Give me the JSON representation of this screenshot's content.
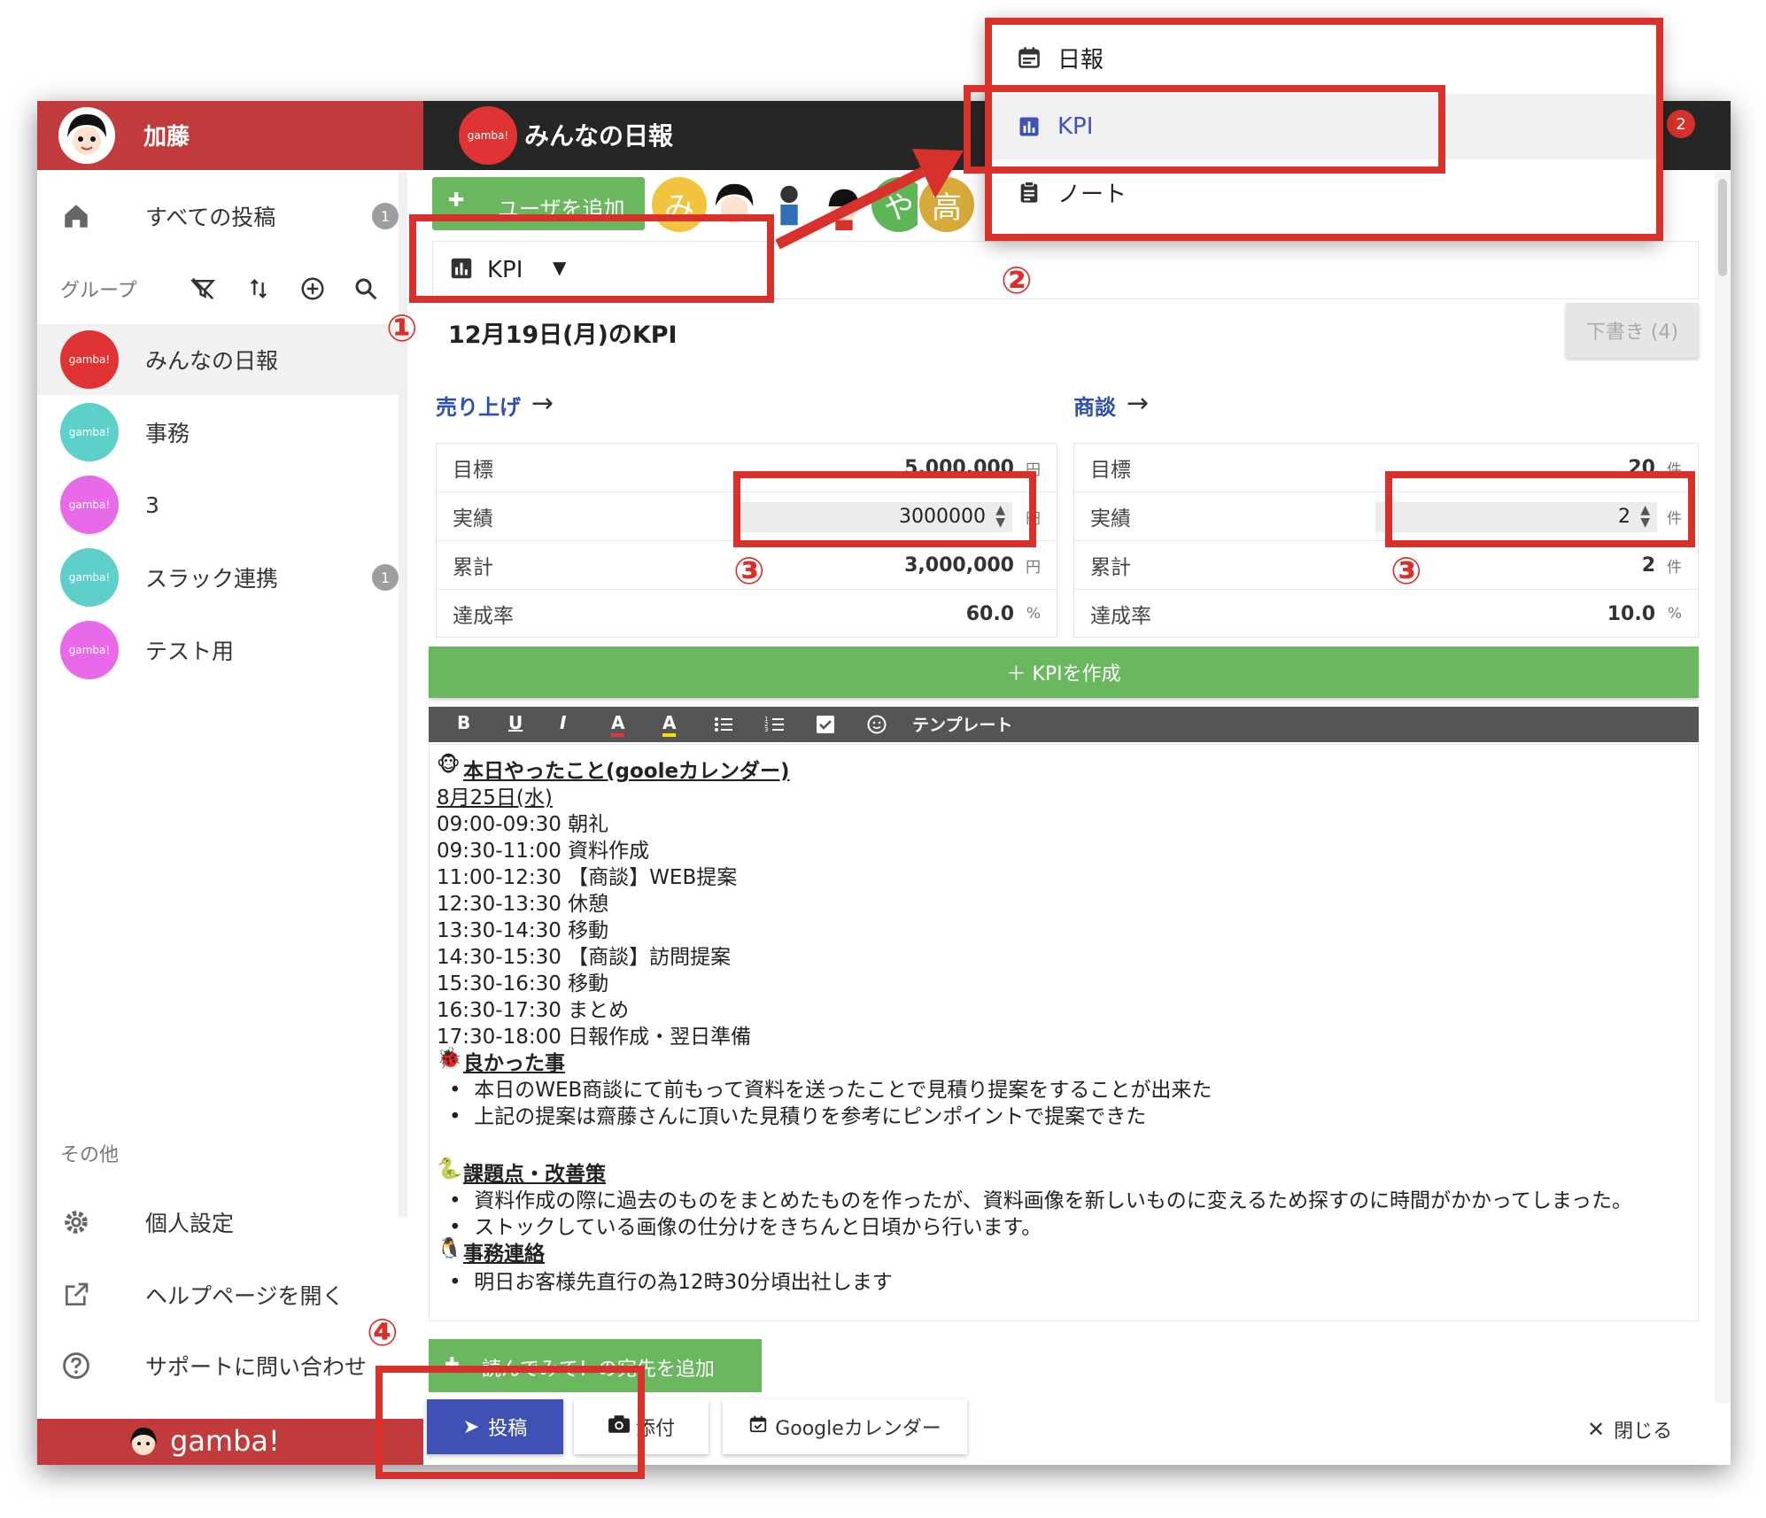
{
  "sidebar": {
    "user_name": "加藤",
    "nav": [
      {
        "label": "すべての投稿",
        "icon": "home-icon",
        "badge": "1"
      }
    ],
    "group_label": "グループ",
    "groups": [
      {
        "label": "みんなの日報",
        "color": "#e03434",
        "active": true
      },
      {
        "label": "事務",
        "color": "#5fd0c9"
      },
      {
        "label": "3",
        "color": "#e86ae8"
      },
      {
        "label": "スラック連携",
        "color": "#5fd0c9",
        "badge": "1"
      },
      {
        "label": "テスト用",
        "color": "#e86ae8"
      }
    ],
    "group_logo_text": "gamba!",
    "other_label": "その他",
    "others": [
      {
        "label": "個人設定",
        "icon": "gear-icon"
      },
      {
        "label": "ヘルプページを開く",
        "icon": "external-link-icon"
      },
      {
        "label": "サポートに問い合わせ",
        "icon": "help-circle-icon"
      }
    ],
    "footer_brand": "gamba!"
  },
  "topbar": {
    "logo_text": "gamba!",
    "title": "みんなの日報",
    "notification_count": "2"
  },
  "main": {
    "add_user_label": "ユーザを追加",
    "member_avatars": [
      "み",
      "や",
      "高"
    ],
    "type_selector": "KPI",
    "kpi_title": "12月19日(月)のKPI",
    "draft_label": "下書き (4)",
    "kpi_cards": [
      {
        "title": "売り上げ",
        "rows": [
          {
            "label": "目標",
            "value": "5,000,000",
            "unit": "円"
          },
          {
            "label": "実績",
            "input": "3000000",
            "unit": "円"
          },
          {
            "label": "累計",
            "value": "3,000,000",
            "unit": "円"
          },
          {
            "label": "達成率",
            "value": "60.0",
            "unit": "%"
          }
        ]
      },
      {
        "title": "商談",
        "rows": [
          {
            "label": "目標",
            "value": "20",
            "unit": "件"
          },
          {
            "label": "実績",
            "input": "2",
            "unit": "件"
          },
          {
            "label": "累計",
            "value": "2",
            "unit": "件"
          },
          {
            "label": "達成率",
            "value": "10.0",
            "unit": "%"
          }
        ]
      }
    ],
    "create_kpi_label": "＋ KPIを作成",
    "editor_toolbar": [
      "B",
      "U",
      "I",
      "A",
      "A",
      "ul",
      "ol",
      "check",
      "emoji"
    ],
    "template_label": "テンプレート",
    "report": {
      "heading1": "本日やったこと(gooleカレンダー)",
      "date": "8月25日(水)",
      "schedule": [
        "09:00-09:30 朝礼",
        "09:30-11:00 資料作成",
        "11:00-12:30 【商談】WEB提案",
        "12:30-13:30 休憩",
        "13:30-14:30 移動",
        "14:30-15:30 【商談】訪問提案",
        "15:30-16:30 移動",
        "16:30-17:30 まとめ",
        "17:30-18:00 日報作成・翌日準備"
      ],
      "heading2": "良かった事",
      "good": [
        "本日のWEB商談にて前もって資料を送ったことで見積り提案をすることが出来た",
        "上記の提案は齋藤さんに頂いた見積りを参考にピンポイントで提案できた"
      ],
      "heading3": "課題点・改善策",
      "issues": [
        "資料作成の際に過去のものをまとめたものを作ったが、資料画像を新しいものに変えるため探すのに時間がかかってしまった。",
        "ストックしている画像の仕分けをきちんと日頃から行います。"
      ],
      "heading4": "事務連絡",
      "notices": [
        "明日お客様先直行の為12時30分頃出社します"
      ]
    },
    "add_recipient_label": "読んでみて！の宛先を追加",
    "post_label": "投稿",
    "attach_label": "添付",
    "calendar_label": "Googleカレンダー",
    "close_label": "閉じる"
  },
  "dropdown": {
    "items": [
      {
        "label": "日報",
        "icon": "calendar-icon"
      },
      {
        "label": "KPI",
        "icon": "bar-chart-icon",
        "active": true
      },
      {
        "label": "ノート",
        "icon": "clipboard-icon"
      }
    ]
  },
  "annotations": [
    "①",
    "②",
    "③",
    "③",
    "④"
  ],
  "colors": {
    "brand_red": "#c13b3d",
    "accent_green": "#6ab760",
    "link_blue": "#2f4fb0",
    "annotation_red": "#d8302a",
    "post_blue": "#3f51b5"
  }
}
